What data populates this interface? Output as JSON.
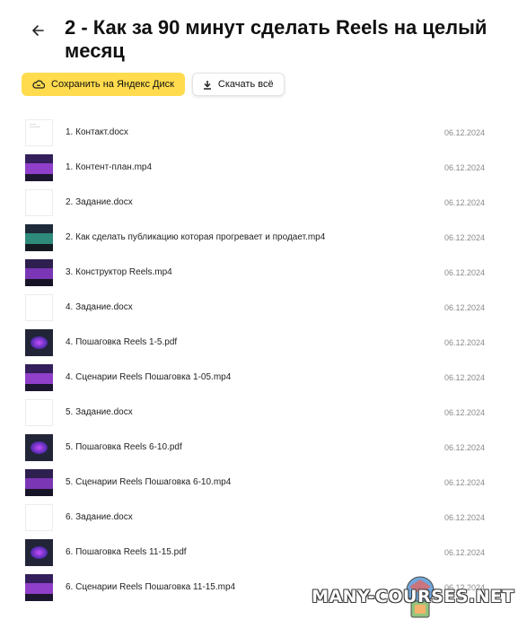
{
  "header": {
    "title": "2 - Как за 90 минут сделать Reels на целый месяц",
    "back_icon": "arrow-left-icon"
  },
  "actions": {
    "save_label": "Сохранить на Яндекс Диск",
    "save_icon": "cloud-icon",
    "download_label": "Скачать всё",
    "download_icon": "download-icon"
  },
  "colors": {
    "accent": "#ffdb4d",
    "date_text": "#8a8a8a"
  },
  "files": [
    {
      "name": "1. Контакт.docx",
      "date": "06.12.2024",
      "type": "docx"
    },
    {
      "name": "1. Контент-план.mp4",
      "date": "06.12.2024",
      "type": "mp4"
    },
    {
      "name": "2. Задание.docx",
      "date": "06.12.2024",
      "type": "docx"
    },
    {
      "name": "2. Как сделать публикацию которая прогревает и продает.mp4",
      "date": "06.12.2024",
      "type": "mp4"
    },
    {
      "name": "3. Конструктор Reels.mp4",
      "date": "06.12.2024",
      "type": "mp4"
    },
    {
      "name": "4. Задание.docx",
      "date": "06.12.2024",
      "type": "docx"
    },
    {
      "name": "4. Пошаговка Reels 1-5.pdf",
      "date": "06.12.2024",
      "type": "pdf"
    },
    {
      "name": "4. Сценарии Reels Пошаговка 1-05.mp4",
      "date": "06.12.2024",
      "type": "mp4"
    },
    {
      "name": "5. Задание.docx",
      "date": "06.12.2024",
      "type": "docx"
    },
    {
      "name": "5. Пошаговка Reels 6-10.pdf",
      "date": "06.12.2024",
      "type": "pdf"
    },
    {
      "name": "5. Сценарии Reels Пошаговка 6-10.mp4",
      "date": "06.12.2024",
      "type": "mp4"
    },
    {
      "name": "6. Задание.docx",
      "date": "06.12.2024",
      "type": "docx"
    },
    {
      "name": "6. Пошаговка Reels 11-15.pdf",
      "date": "06.12.2024",
      "type": "pdf"
    },
    {
      "name": "6. Сценарии Reels Пошаговка 11-15.mp4",
      "date": "06.12.2024",
      "type": "mp4"
    }
  ],
  "watermark": "MANY-COURSES.NET"
}
